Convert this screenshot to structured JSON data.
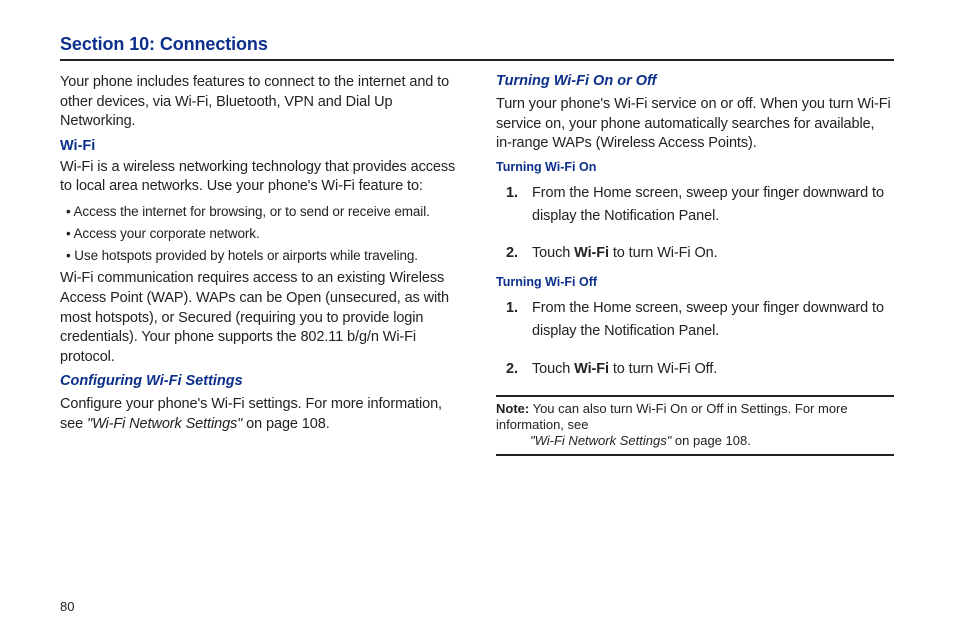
{
  "section_title": "Section 10: Connections",
  "intro": "Your phone includes features to connect to the internet and to other devices, via Wi-Fi, Bluetooth, VPN and Dial Up Networking.",
  "wifi": {
    "heading": "Wi-Fi",
    "desc": "Wi-Fi is a wireless networking technology that provides access to local area networks. Use your phone's Wi-Fi feature to:",
    "bullets": [
      "• Access the internet for browsing, or to send or receive email.",
      "• Access your corporate network.",
      "• Use hotspots provided by hotels or airports while traveling."
    ],
    "para2": "Wi-Fi communication requires access to an existing Wireless Access Point (WAP). WAPs can be Open (unsecured, as with most hotspots), or Secured (requiring you to provide login credentials). Your phone supports the 802.11 b/g/n Wi-Fi protocol."
  },
  "config": {
    "heading": "Configuring Wi-Fi Settings",
    "text_pre": "Configure your phone's Wi-Fi settings. For more information, see ",
    "ref": "\"Wi-Fi Network Settings\"",
    "text_post": " on page 108."
  },
  "toggle": {
    "heading": "Turning Wi-Fi On or Off",
    "desc": "Turn your phone's Wi-Fi service on or off. When you turn Wi-Fi service on, your phone automatically searches for available, in-range WAPs (Wireless Access Points).",
    "on": {
      "heading": "Turning Wi-Fi On",
      "steps": [
        {
          "n": "1.",
          "text": "From the Home screen, sweep your finger downward to display the Notification Panel."
        },
        {
          "n": "2.",
          "pre": "Touch ",
          "bold": "Wi-Fi",
          "post": " to turn Wi-Fi On."
        }
      ]
    },
    "off": {
      "heading": "Turning Wi-Fi Off",
      "steps": [
        {
          "n": "1.",
          "text": "From the Home screen, sweep your finger downward to display the Notification Panel."
        },
        {
          "n": "2.",
          "pre": "Touch ",
          "bold": "Wi-Fi",
          "post": " to turn Wi-Fi Off."
        }
      ]
    }
  },
  "note": {
    "label": "Note:",
    "pre": " You can also turn Wi-Fi On or Off in Settings. For more information, see ",
    "ref": "\"Wi-Fi Network Settings\"",
    "post": " on page 108."
  },
  "page_number": "80"
}
